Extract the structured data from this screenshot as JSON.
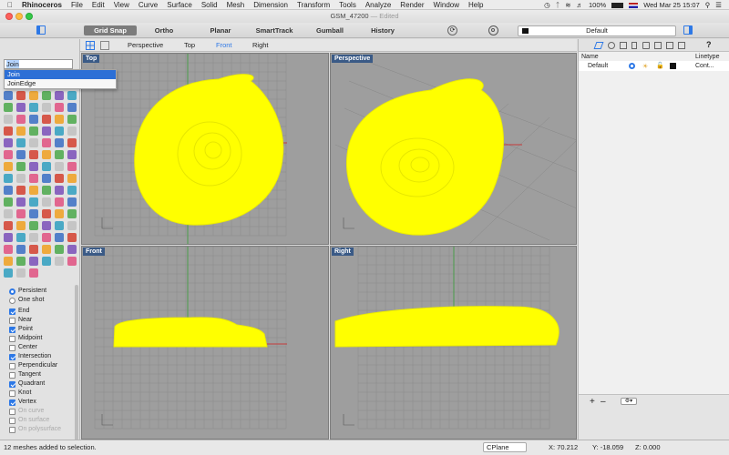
{
  "menubar": {
    "apple": "",
    "app_name": "Rhinoceros",
    "items": [
      "File",
      "Edit",
      "View",
      "Curve",
      "Surface",
      "Solid",
      "Mesh",
      "Dimension",
      "Transform",
      "Tools",
      "Analyze",
      "Render",
      "Window",
      "Help"
    ],
    "battery": "100%",
    "clock": "Wed Mar 25  15:07"
  },
  "titlebar": {
    "title": "GSM_47200",
    "status": "— Edited"
  },
  "toolbar": {
    "grid_snap": "Grid Snap",
    "ortho": "Ortho",
    "planar": "Planar",
    "smarttrack": "SmartTrack",
    "gumball": "Gumball",
    "history": "History",
    "layer": "Default"
  },
  "command": {
    "input": "Join",
    "suggestions": [
      "Join",
      "JoinEdge"
    ]
  },
  "osnaps": {
    "persistent": "Persistent",
    "one_shot": "One shot",
    "items": [
      {
        "label": "End",
        "checked": true
      },
      {
        "label": "Near",
        "checked": false
      },
      {
        "label": "Point",
        "checked": true
      },
      {
        "label": "Midpoint",
        "checked": false
      },
      {
        "label": "Center",
        "checked": false
      },
      {
        "label": "Intersection",
        "checked": true
      },
      {
        "label": "Perpendicular",
        "checked": false
      },
      {
        "label": "Tangent",
        "checked": false
      },
      {
        "label": "Quadrant",
        "checked": true
      },
      {
        "label": "Knot",
        "checked": false
      },
      {
        "label": "Vertex",
        "checked": true
      },
      {
        "label": "On curve",
        "checked": false
      },
      {
        "label": "On surface",
        "checked": false
      },
      {
        "label": "On polysurface",
        "checked": false
      }
    ]
  },
  "viewport_tabs": {
    "perspective": "Perspective",
    "top": "Top",
    "front": "Front",
    "right": "Right"
  },
  "viewports": {
    "top": "Top",
    "perspective": "Perspective",
    "front": "Front",
    "right": "Right"
  },
  "layers": {
    "col_name": "Name",
    "col_linetype": "Linetype",
    "row_name": "Default",
    "row_linetype": "Cont..."
  },
  "status": {
    "message": "12 meshes added to selection.",
    "cplane": "CPlane",
    "x": "X: 70.212",
    "y": "Y: -18.059",
    "z": "Z: 0.000"
  },
  "colors": {
    "mesh_yellow": "#ffff00",
    "viewport_bg": "#9e9e9e",
    "accent_blue": "#2d78e6",
    "x_axis": "#c43a3a",
    "y_axis": "#3aa43a"
  }
}
